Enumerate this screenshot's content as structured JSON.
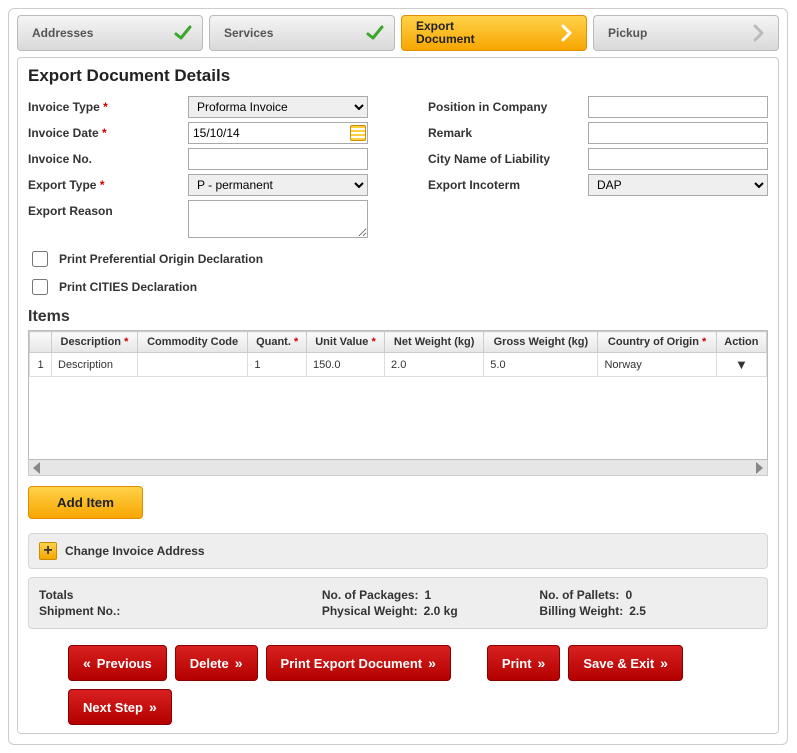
{
  "steps": {
    "addresses": "Addresses",
    "services": "Services",
    "export_document": "Export Document",
    "pickup": "Pickup"
  },
  "section_title": "Export Document Details",
  "labels": {
    "invoice_type": "Invoice Type",
    "invoice_date": "Invoice Date",
    "invoice_no": "Invoice No.",
    "export_type": "Export Type",
    "export_reason": "Export Reason",
    "position_in_company": "Position in Company",
    "remark": "Remark",
    "city_of_liability": "City Name of Liability",
    "export_incoterm": "Export Incoterm"
  },
  "values": {
    "invoice_type": "Proforma Invoice",
    "invoice_date": "15/10/14",
    "invoice_no": "",
    "export_type": "P - permanent",
    "export_reason": "",
    "position_in_company": "",
    "remark": "",
    "city_of_liability": "",
    "export_incoterm": "DAP"
  },
  "checkboxes": {
    "print_pref_origin": "Print Preferential Origin Declaration",
    "print_cities": "Print CITIES Declaration"
  },
  "items_header": "Items",
  "grid": {
    "cols": {
      "num": "",
      "description": "Description",
      "commodity": "Commodity Code",
      "quant": "Quant.",
      "unit_value": "Unit Value",
      "net_weight": "Net Weight (kg)",
      "gross_weight": "Gross Weight (kg)",
      "country": "Country of Origin",
      "action": "Action"
    },
    "rows": [
      {
        "num": "1",
        "description": "Description",
        "commodity": "",
        "quant": "1",
        "unit_value": "150.0",
        "net_weight": "2.0",
        "gross_weight": "5.0",
        "country": "Norway"
      }
    ]
  },
  "add_item": "Add Item",
  "accordion": {
    "change_invoice_address": "Change Invoice Address"
  },
  "totals": {
    "totals_label": "Totals",
    "shipment_no_label": "Shipment No.:",
    "shipment_no_value": "",
    "packages_label": "No. of Packages:",
    "packages_value": "1",
    "pallets_label": "No. of Pallets:",
    "pallets_value": "0",
    "phys_weight_label": "Physical Weight:",
    "phys_weight_value": "2.0 kg",
    "bill_weight_label": "Billing Weight:",
    "bill_weight_value": "2.5"
  },
  "buttons": {
    "previous": "Previous",
    "delete": "Delete",
    "print_export_doc": "Print Export Document",
    "print": "Print",
    "save_exit": "Save & Exit",
    "next_step": "Next Step"
  }
}
